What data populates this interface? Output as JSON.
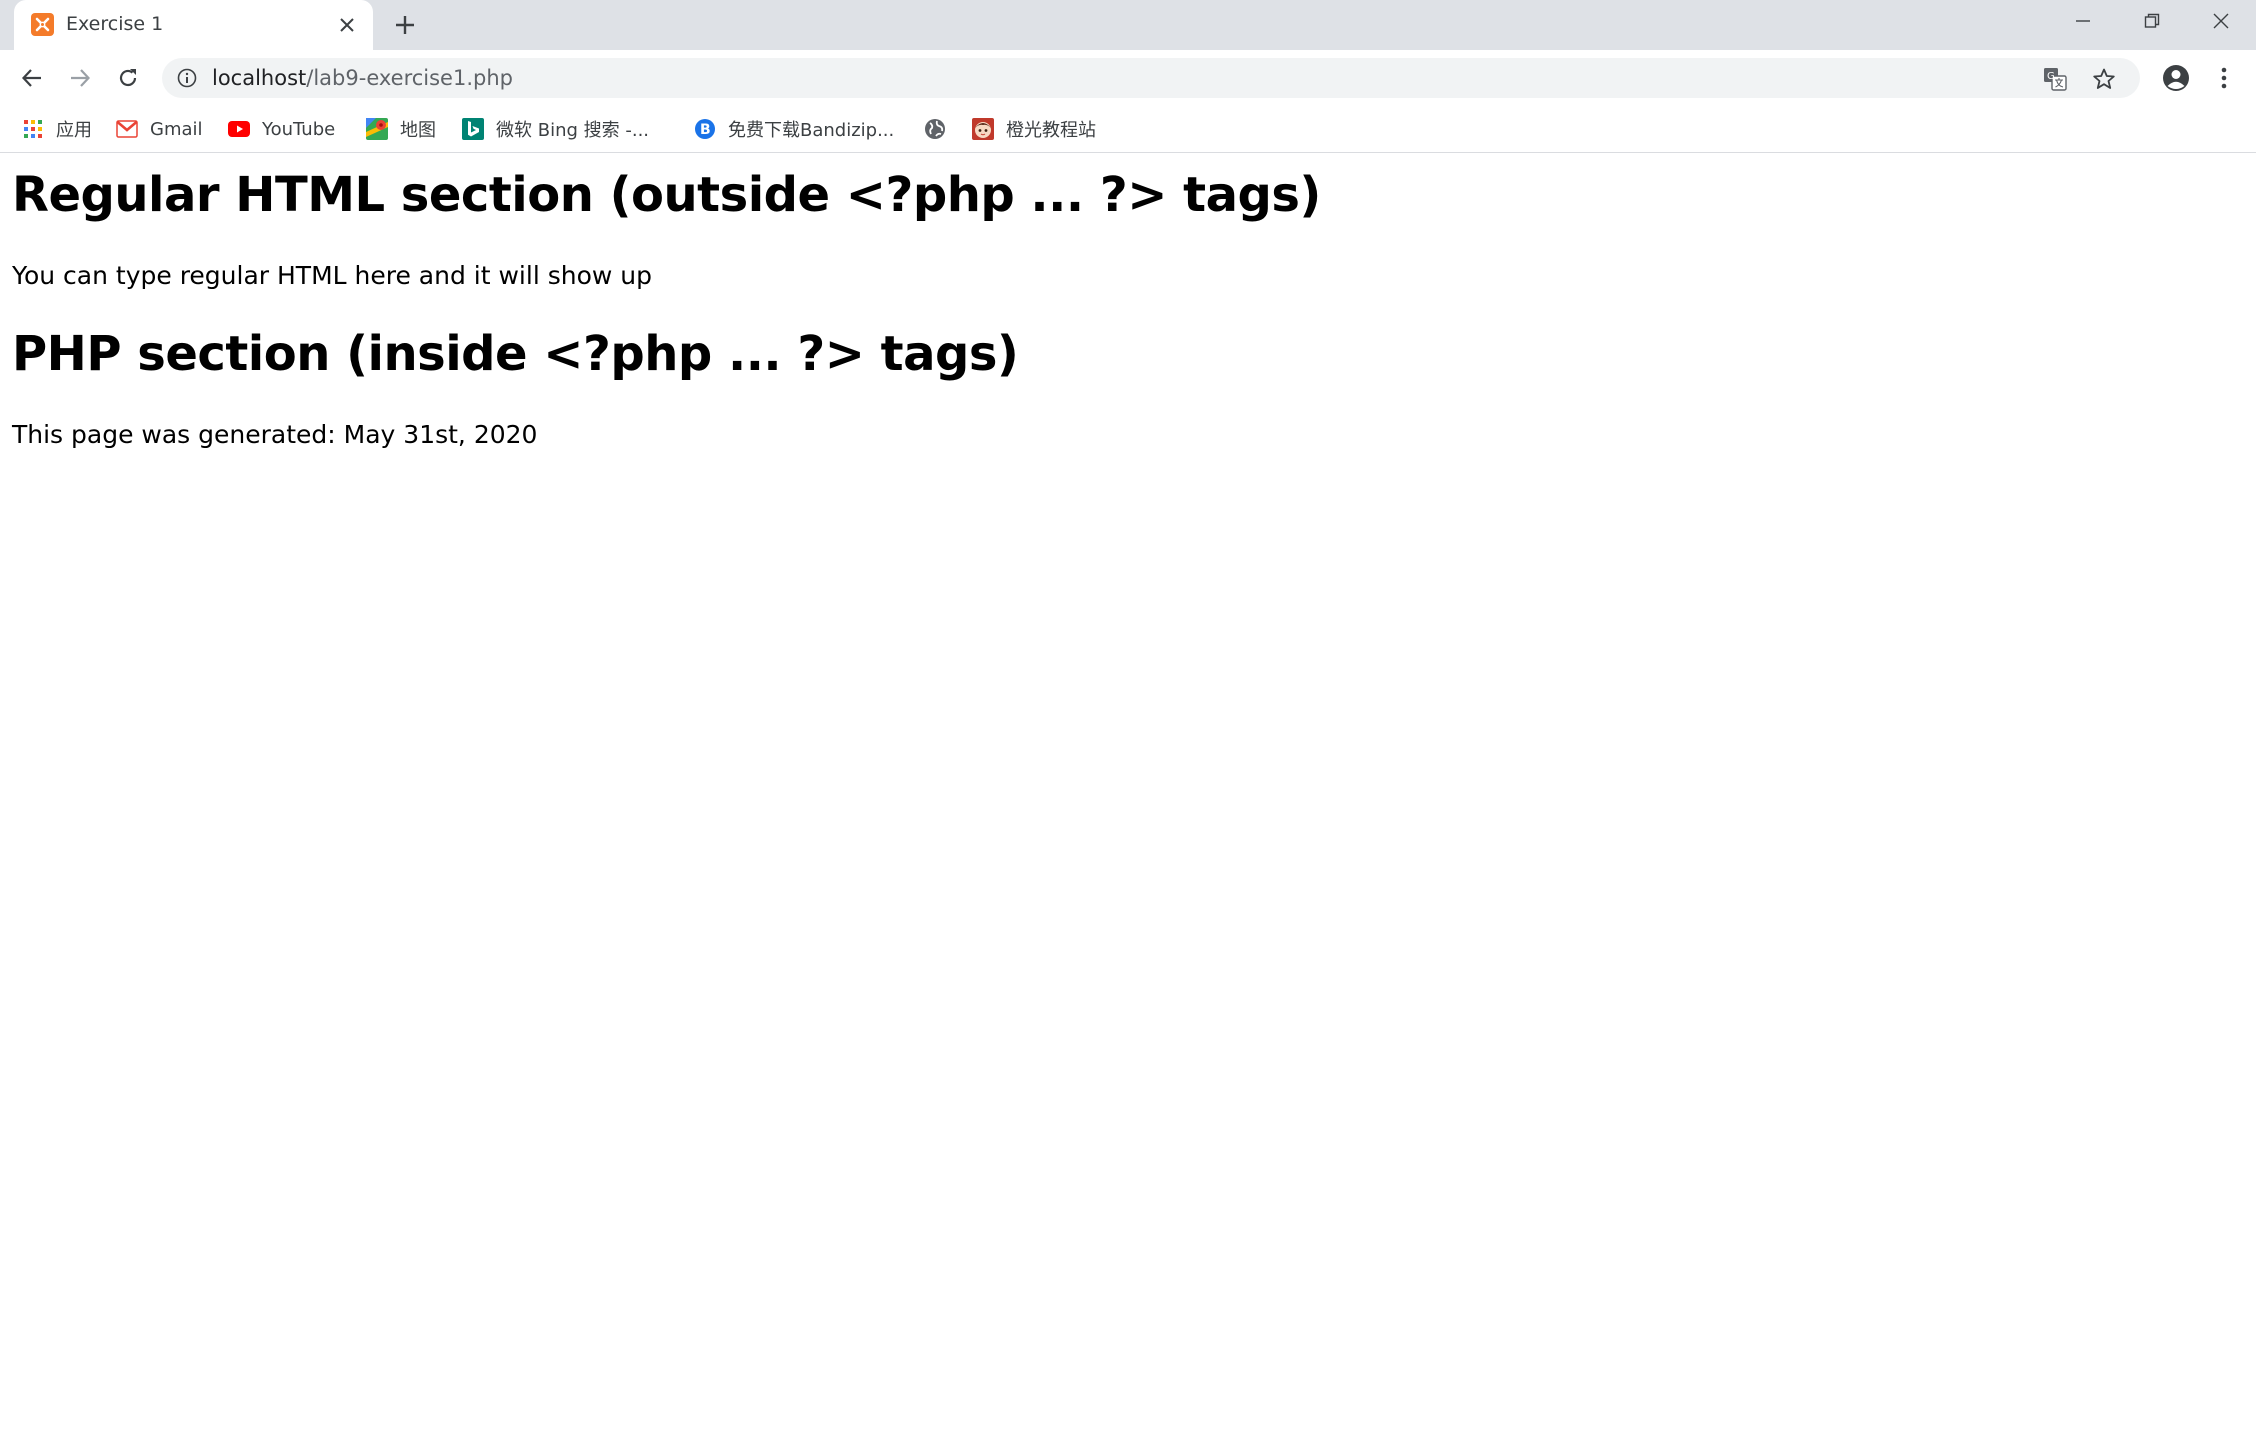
{
  "tab": {
    "title": "Exercise 1"
  },
  "address_bar": {
    "host": "localhost",
    "path": "/lab9-exercise1.php"
  },
  "bookmarks": [
    {
      "label": "应用",
      "icon": "apps-grid-icon"
    },
    {
      "label": "Gmail",
      "icon": "gmail-icon"
    },
    {
      "label": "YouTube",
      "icon": "youtube-icon"
    },
    {
      "label": "地图",
      "icon": "maps-icon"
    },
    {
      "label": "微软 Bing 搜索 -...",
      "icon": "bing-icon"
    },
    {
      "label": "免费下载Bandizip...",
      "icon": "bandizip-icon"
    },
    {
      "label": "",
      "icon": "globe-icon"
    },
    {
      "label": "橙光教程站",
      "icon": "site-favicon-icon"
    }
  ],
  "page": {
    "heading_1": "Regular HTML section (outside <?php ... ?> tags)",
    "paragraph_1": "You can type regular HTML here and it will show up",
    "heading_2": "PHP section (inside <?php ... ?> tags)",
    "paragraph_2": "This page was generated: May 31st, 2020"
  },
  "colors": {
    "tabstrip_bg": "#dee1e6",
    "omnibox_bg": "#f1f3f4",
    "favicon_orange": "#f47b2a",
    "youtube_red": "#ff0000",
    "gmail_red": "#ea4335",
    "bing_teal": "#008373",
    "bandizip_blue": "#1a73e8"
  }
}
